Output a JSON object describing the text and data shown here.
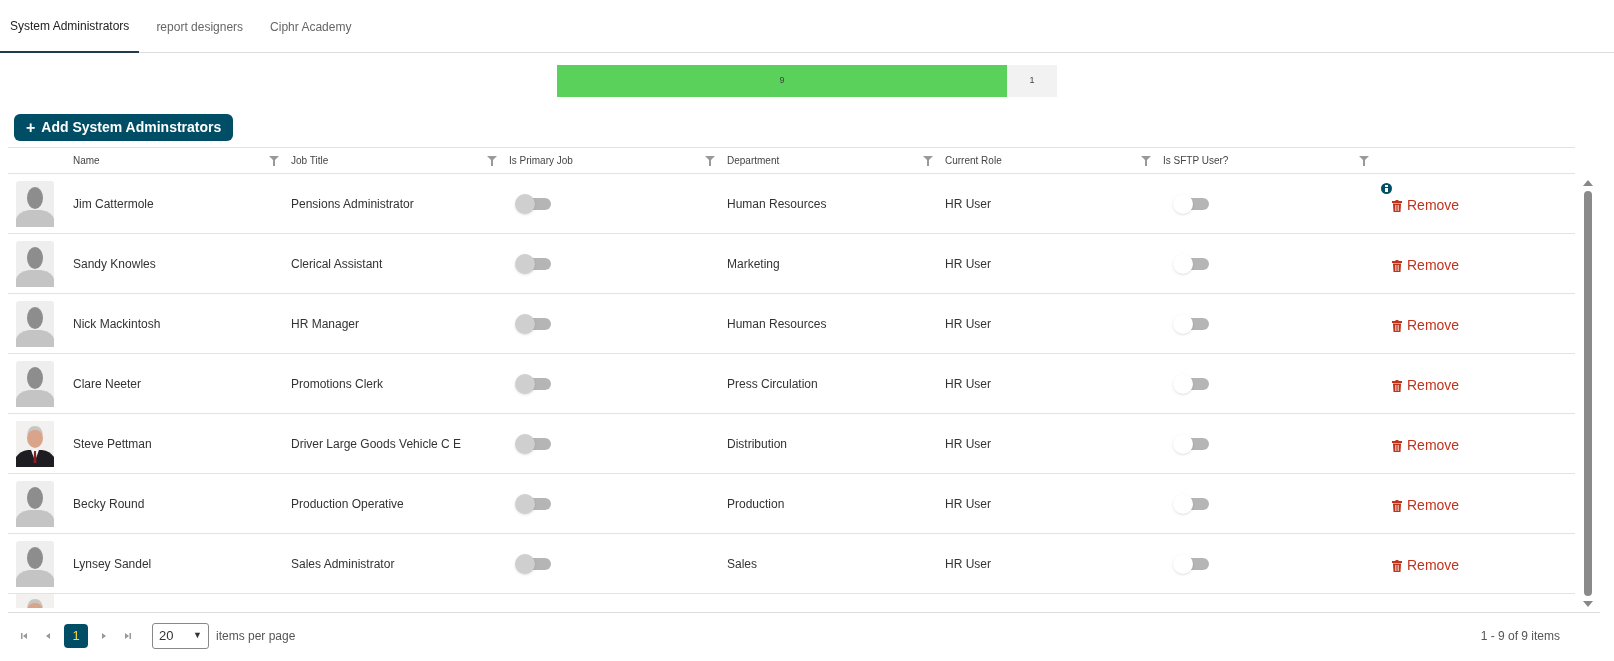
{
  "tabs": [
    {
      "label": "System Administrators",
      "selected": true
    },
    {
      "label": "report designers",
      "selected": false
    },
    {
      "label": "Ciphr Academy",
      "selected": false
    }
  ],
  "summary_bar": {
    "level": 0.9,
    "color": "#5ad15a",
    "fill_label": "9",
    "rest_label": "1"
  },
  "add_button": {
    "icon": "+",
    "label": "Add System Adminstrators"
  },
  "table": {
    "columns": [
      "Name",
      "Job Title",
      "Is Primary Job",
      "Department",
      "Current Role",
      "Is SFTP User?"
    ],
    "rows": [
      {
        "avatar": {
          "kind": "placeholder"
        },
        "name": "Jim Cattermole",
        "job_title": "Pensions Administrator",
        "primary_job": {
          "on": false,
          "disabled": true
        },
        "department": "Human Resources",
        "role": "HR User",
        "sftp": {
          "on": false
        },
        "info": true,
        "action": "Remove"
      },
      {
        "avatar": {
          "kind": "placeholder"
        },
        "name": "Sandy Knowles",
        "job_title": "Clerical Assistant",
        "primary_job": {
          "on": false,
          "disabled": true
        },
        "department": "Marketing",
        "role": "HR User",
        "sftp": {
          "on": false
        },
        "info": false,
        "action": "Remove"
      },
      {
        "avatar": {
          "kind": "placeholder"
        },
        "name": "Nick Mackintosh",
        "job_title": "HR Manager",
        "primary_job": {
          "on": false,
          "disabled": true
        },
        "department": "Human Resources",
        "role": "HR User",
        "sftp": {
          "on": false
        },
        "info": false,
        "action": "Remove"
      },
      {
        "avatar": {
          "kind": "placeholder"
        },
        "name": "Clare Neeter",
        "job_title": "Promotions Clerk",
        "primary_job": {
          "on": false,
          "disabled": true
        },
        "department": "Press Circulation",
        "role": "HR User",
        "sftp": {
          "on": false
        },
        "info": false,
        "action": "Remove"
      },
      {
        "avatar": {
          "kind": "picture"
        },
        "name": "Steve Pettman",
        "job_title": "Driver Large Goods Vehicle C E",
        "primary_job": {
          "on": false,
          "disabled": true
        },
        "department": "Distribution",
        "role": "HR User",
        "sftp": {
          "on": false
        },
        "info": false,
        "action": "Remove"
      },
      {
        "avatar": {
          "kind": "placeholder"
        },
        "name": "Becky Round",
        "job_title": "Production Operative",
        "primary_job": {
          "on": false,
          "disabled": true
        },
        "department": "Production",
        "role": "HR User",
        "sftp": {
          "on": false
        },
        "info": false,
        "action": "Remove"
      },
      {
        "avatar": {
          "kind": "placeholder"
        },
        "name": "Lynsey Sandel",
        "job_title": "Sales Administrator",
        "primary_job": {
          "on": false,
          "disabled": true
        },
        "department": "Sales",
        "role": "HR User",
        "sftp": {
          "on": false
        },
        "info": false,
        "action": "Remove"
      }
    ],
    "partial_row": {
      "avatar": {
        "kind": "picture"
      }
    }
  },
  "pager": {
    "pages": [
      {
        "label": "1",
        "selected": true
      }
    ],
    "page_size": "20",
    "size_caret": "▼",
    "size_label": "items per page",
    "summary": "1 - 9 of 9 items"
  }
}
